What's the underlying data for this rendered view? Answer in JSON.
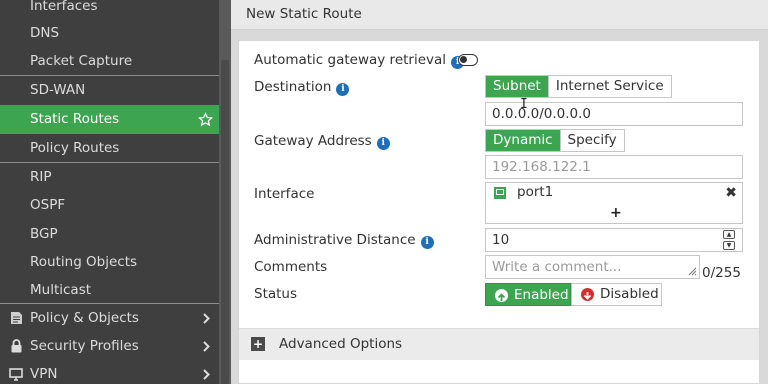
{
  "sidebar": {
    "items": [
      {
        "label": "Interfaces"
      },
      {
        "label": "DNS"
      },
      {
        "label": "Packet Capture"
      },
      {
        "label": "SD-WAN"
      },
      {
        "label": "Static Routes"
      },
      {
        "label": "Policy Routes"
      },
      {
        "label": "RIP"
      },
      {
        "label": "OSPF"
      },
      {
        "label": "BGP"
      },
      {
        "label": "Routing Objects"
      },
      {
        "label": "Multicast"
      }
    ],
    "sections": [
      {
        "label": "Policy & Objects",
        "icon": "policy-icon"
      },
      {
        "label": "Security Profiles",
        "icon": "lock-icon"
      },
      {
        "label": "VPN",
        "icon": "monitor-icon"
      }
    ],
    "active_item": "Static Routes",
    "accent_color": "#3da550"
  },
  "header": {
    "title": "New Static Route"
  },
  "form": {
    "auto_gateway_label": "Automatic gateway retrieval",
    "auto_gateway_enabled": false,
    "destination_label": "Destination",
    "destination_options": [
      "Subnet",
      "Internet Service"
    ],
    "destination_selected": "Subnet",
    "destination_value": "0.0.0.0/0.0.0.0",
    "gateway_label": "Gateway Address",
    "gateway_options": [
      "Dynamic",
      "Specify"
    ],
    "gateway_selected": "Dynamic",
    "gateway_value": "192.168.122.1",
    "interface_label": "Interface",
    "interface_value": "port1",
    "admin_distance_label": "Administrative Distance",
    "admin_distance_value": "10",
    "comments_label": "Comments",
    "comments_placeholder": "Write a comment...",
    "comments_counter": "0/255",
    "status_label": "Status",
    "status_options": [
      "Enabled",
      "Disabled"
    ],
    "status_selected": "Enabled",
    "advanced_label": "Advanced Options"
  }
}
